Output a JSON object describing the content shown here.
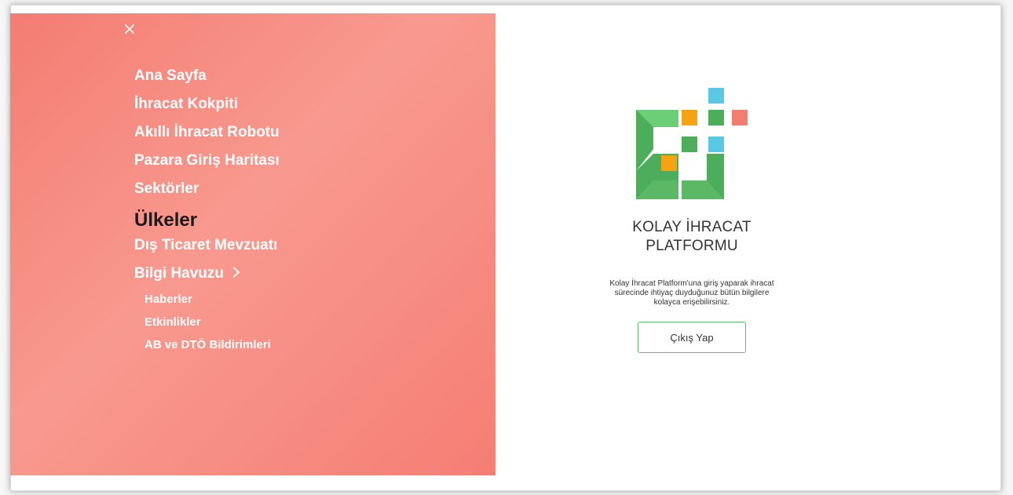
{
  "menu": {
    "items": [
      {
        "label": "Ana Sayfa"
      },
      {
        "label": "İhracat Kokpiti"
      },
      {
        "label": "Akıllı İhracat Robotu"
      },
      {
        "label": "Pazara Giriş Haritası"
      },
      {
        "label": "Sektörler"
      },
      {
        "label": "Ülkeler",
        "active": true
      },
      {
        "label": "Dış Ticaret Mevzuatı"
      },
      {
        "label": "Bilgi Havuzu"
      }
    ],
    "sub_items": [
      {
        "label": "Haberler"
      },
      {
        "label": "Etkinlikler"
      },
      {
        "label": "AB ve DTÖ Bildirimleri"
      }
    ],
    "background_colors": [
      "#f47d72",
      "#f8998f"
    ],
    "text_color": "#ffffff",
    "active_text_color": "#1a1a1a"
  },
  "brand": {
    "title_line1": "KOLAY İHRACAT",
    "title_line2": "PLATFORMU",
    "description": "Kolay İhracat Platform'una giriş yaparak ihracat sürecinde ihtiyaç duyduğunuz bütün bilgilere kolayca erişebilirsiniz.",
    "logout_label": "Çıkış Yap",
    "logo_colors": {
      "green_dark": "#4cae5b",
      "green_light": "#6ccf77",
      "orange": "#f5a313",
      "blue": "#5ac8e3",
      "red": "#f47d72"
    }
  },
  "icons": {
    "close": "close-icon",
    "submenu_chevron": "chevron-right-icon"
  }
}
